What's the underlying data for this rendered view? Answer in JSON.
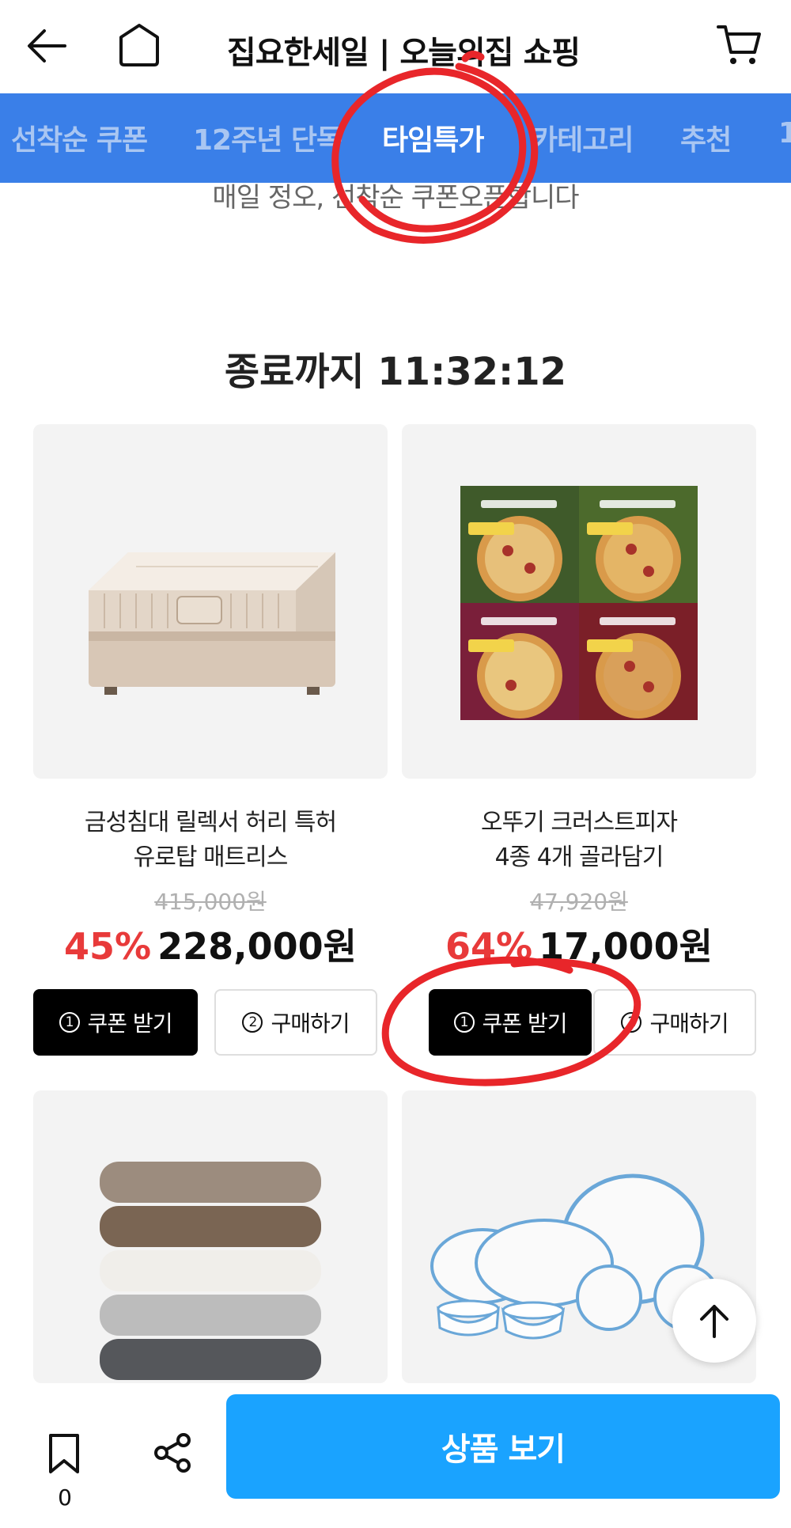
{
  "header": {
    "title": "집요한세일 | 오늘의집 쇼핑",
    "cart_count": ""
  },
  "tabs": [
    {
      "label": "선착순 쿠폰",
      "active": false
    },
    {
      "label": "12주년 단독",
      "active": false
    },
    {
      "label": "타임특가",
      "active": true
    },
    {
      "label": "카테고리",
      "active": false
    },
    {
      "label": "추천",
      "active": false
    },
    {
      "label": "1",
      "active": false
    }
  ],
  "content": {
    "subtitle": "매일 정오, 선착순 쿠폰오픈합니다",
    "countdown": "종료까지 11:32:12"
  },
  "products": [
    {
      "name_line1": "금성침대 릴렉서 허리 특허",
      "name_line2": "유로탑 매트리스",
      "original_price": "415,000원",
      "discount": "45%",
      "price": "228,000원",
      "coupon_label": "쿠폰 받기",
      "coupon_step": "1",
      "buy_label": "구매하기",
      "buy_step": "2",
      "image": "mattress"
    },
    {
      "name_line1": "오뚜기 크러스트피자",
      "name_line2": "4종 4개 골라담기",
      "original_price": "47,920원",
      "discount": "64%",
      "price": "17,000원",
      "coupon_label": "쿠폰 받기",
      "coupon_step": "1",
      "buy_label": "구매하기",
      "buy_step": "2",
      "image": "pizza"
    },
    {
      "image": "towels"
    },
    {
      "image": "dishes"
    }
  ],
  "bottom_bar": {
    "bookmark_count": "0",
    "cta_label": "상품 보기"
  },
  "colors": {
    "tab_bar": "#3a7fe8",
    "discount": "#e83a3a",
    "cta": "#1aa3ff",
    "annotation": "#e8262a"
  },
  "icons": [
    "back-arrow-icon",
    "home-icon",
    "cart-icon",
    "bookmark-icon",
    "share-icon",
    "arrow-up-icon"
  ]
}
